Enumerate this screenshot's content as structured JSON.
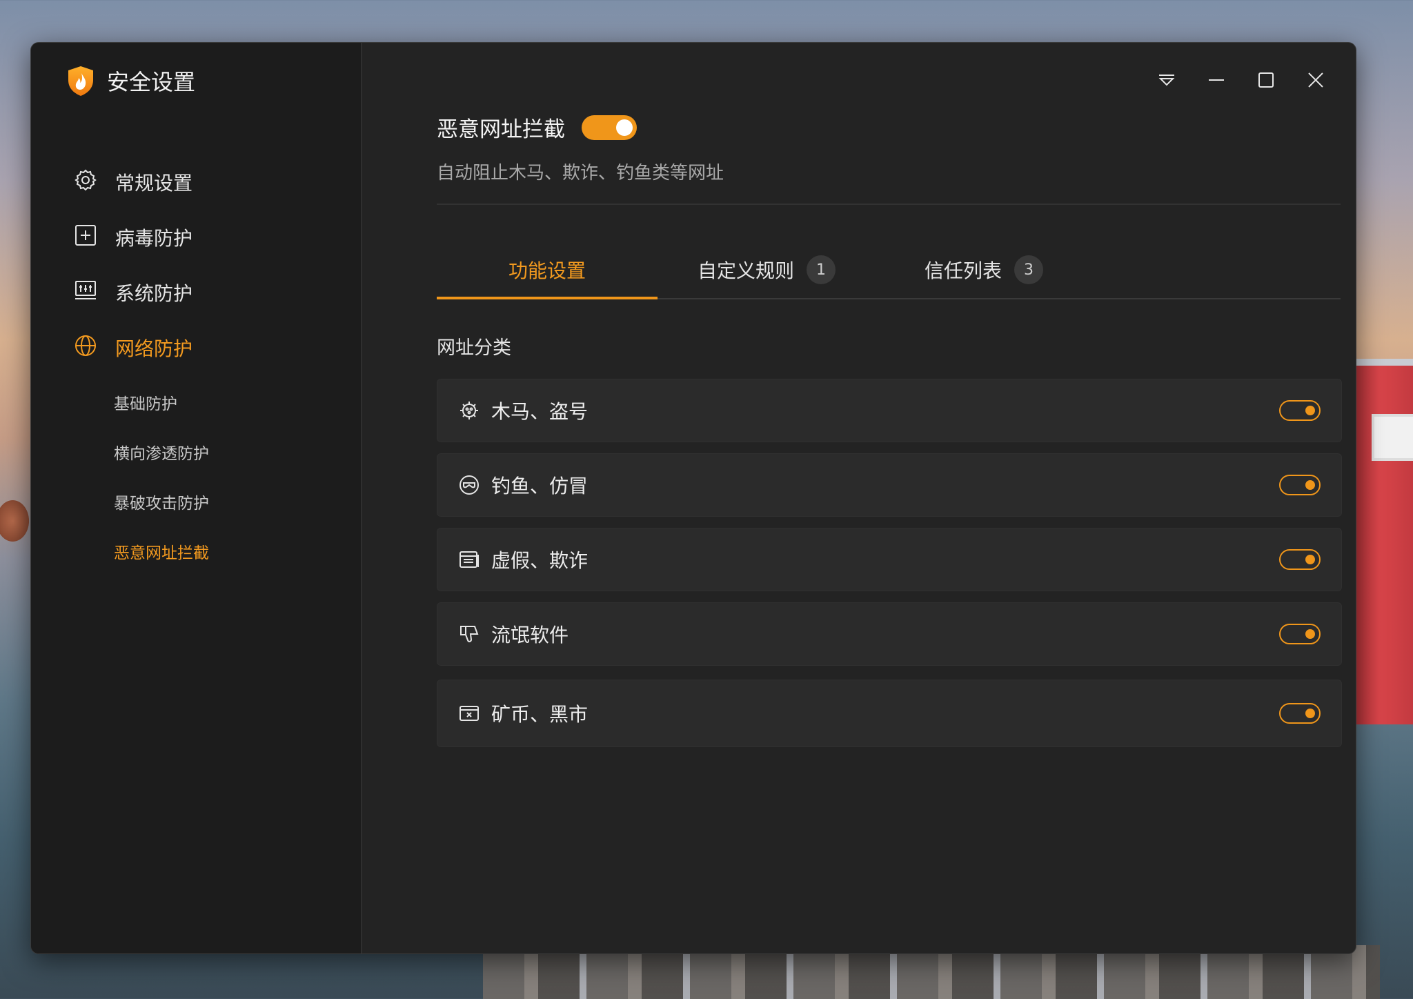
{
  "app": {
    "title": "安全设置",
    "accent": "#f0961a"
  },
  "sidebar": {
    "items": [
      {
        "label": "常规设置",
        "icon": "gear-icon"
      },
      {
        "label": "病毒防护",
        "icon": "plus-square-icon"
      },
      {
        "label": "系统防护",
        "icon": "system-monitor-icon"
      },
      {
        "label": "网络防护",
        "icon": "globe-icon",
        "active": true
      }
    ],
    "subitems": [
      {
        "label": "基础防护"
      },
      {
        "label": "横向渗透防护"
      },
      {
        "label": "暴破攻击防护"
      },
      {
        "label": "恶意网址拦截",
        "active": true
      }
    ]
  },
  "window_controls": [
    "dropdown-icon",
    "minimize-icon",
    "maximize-icon",
    "close-icon"
  ],
  "feature": {
    "title": "恶意网址拦截",
    "enabled": true,
    "description": "自动阻止木马、欺诈、钓鱼类等网址"
  },
  "tabs": [
    {
      "label": "功能设置",
      "active": true
    },
    {
      "label": "自定义规则",
      "badge": "1"
    },
    {
      "label": "信任列表",
      "badge": "3"
    }
  ],
  "section": {
    "label": "网址分类"
  },
  "categories": [
    {
      "label": "木马、盗号",
      "icon": "virus-icon",
      "enabled": true
    },
    {
      "label": "钓鱼、仿冒",
      "icon": "mask-icon",
      "enabled": true
    },
    {
      "label": "虚假、欺诈",
      "icon": "fake-page-icon",
      "enabled": true
    },
    {
      "label": "流氓软件",
      "icon": "thumbs-down-icon",
      "enabled": true
    },
    {
      "label": "矿币、黑市",
      "icon": "blocked-window-icon",
      "enabled": true
    }
  ]
}
